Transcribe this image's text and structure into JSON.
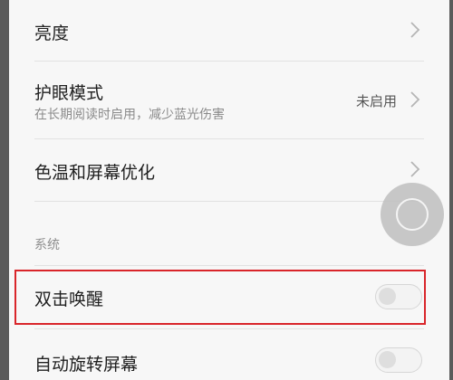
{
  "settings": {
    "brightness": {
      "title": "亮度"
    },
    "eye_protection": {
      "title": "护眼模式",
      "subtitle": "在长期阅读时启用，减少蓝光伤害",
      "value": "未启用"
    },
    "color_temp": {
      "title": "色温和屏幕优化"
    },
    "section_system": "系统",
    "double_tap_wake": {
      "title": "双击唤醒",
      "enabled": false
    },
    "auto_rotate": {
      "title": "自动旋转屏幕",
      "enabled": false
    }
  },
  "colors": {
    "highlight": "#d9252a",
    "background": "#f7f7f7"
  },
  "icons": {
    "chevron": "chevron-right-icon",
    "floating": "assistive-touch-icon"
  }
}
